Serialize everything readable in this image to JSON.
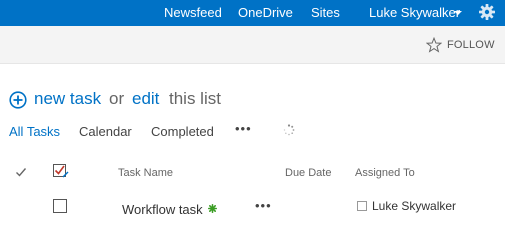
{
  "suite_bar": {
    "links": [
      "Newsfeed",
      "OneDrive",
      "Sites"
    ],
    "active_link": "Sites",
    "user_name": "Luke Skywalker",
    "settings_icon": "gear-icon",
    "bar_color": "#0072c6"
  },
  "ribbon": {
    "follow_label": "FOLLOW",
    "follow_icon": "star-icon"
  },
  "actions": {
    "new_task": "new task",
    "or": "or",
    "edit": "edit",
    "this_list": "this list"
  },
  "views": {
    "tabs": [
      "All Tasks",
      "Calendar",
      "Completed"
    ],
    "selected": "All Tasks",
    "more": "•••"
  },
  "table": {
    "columns": [
      "Task Name",
      "Due Date",
      "Assigned To"
    ],
    "rows": [
      {
        "task_name": "Workflow task",
        "is_new": true,
        "menu": "•••",
        "due_date": "",
        "assigned_to": "Luke Skywalker"
      }
    ]
  },
  "colors": {
    "accent": "#0072c6",
    "new_badge": "#3a9d23"
  }
}
